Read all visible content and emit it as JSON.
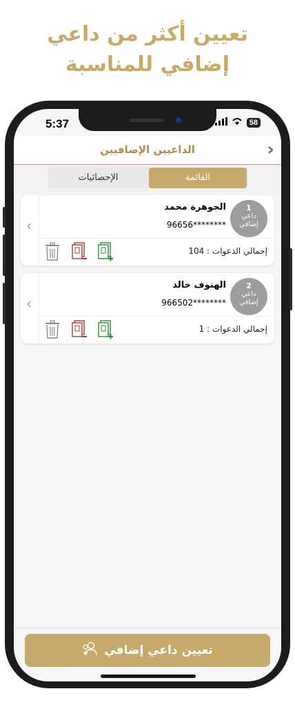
{
  "headline": {
    "line1": "تعيين أكثر من داعي",
    "line2": "إضافي للمناسبة"
  },
  "status": {
    "time": "5:37",
    "battery": "58"
  },
  "nav": {
    "title": "الداعيين الإضافيين",
    "back_icon": "chevron-right-icon"
  },
  "segments": {
    "list": "القائمة",
    "stats": "الإحصائيات",
    "selected": "list"
  },
  "cards": [
    {
      "badge_num": "1",
      "badge_label1": "داعي",
      "badge_label2": "إضافي",
      "name": "الجوهرة محمد",
      "phone": "96656********",
      "total": "إجمالي الدعوات : 104"
    },
    {
      "badge_num": "2",
      "badge_label1": "داعي",
      "badge_label2": "إضافي",
      "name": "الهنوف خالد",
      "phone": "966502********",
      "total": "إجمالي الدعوات : 1"
    }
  ],
  "cta": {
    "label": "تعيين داعي إضافي",
    "icon": "add-user-icon"
  },
  "colors": {
    "accent": "#C6A96B",
    "delete": "#8a8a8a",
    "remove": "#a33a3a",
    "add": "#2f8a3a"
  }
}
